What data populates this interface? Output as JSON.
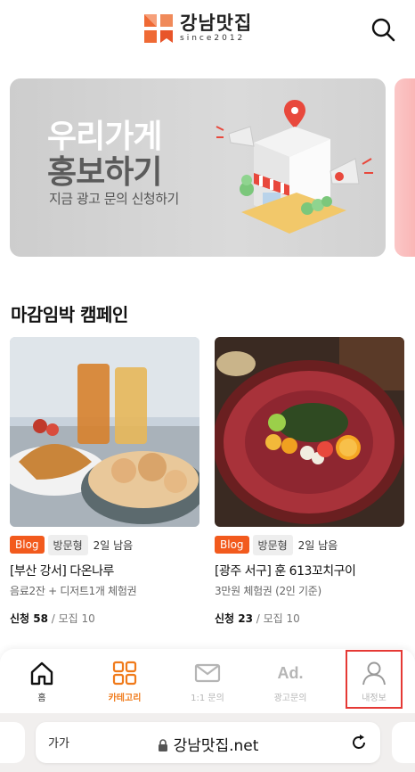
{
  "header": {
    "brand_name": "강남맛집",
    "brand_since": "since2012"
  },
  "banner": {
    "title_line1": "우리가게",
    "title_line2": "홍보하기",
    "subtitle": "지금 광고 문의 신청하기"
  },
  "section": {
    "title": "마감임박 캠페인"
  },
  "campaigns": [
    {
      "blog_tag": "Blog",
      "type_tag": "방문형",
      "days_left": "2일 남음",
      "title": "[부산 강서] 다온나루",
      "desc": "음료2잔 + 디저트1개 체험권",
      "applied_label": "신청 58",
      "recruit_label": " / 모집 10"
    },
    {
      "blog_tag": "Blog",
      "type_tag": "방문형",
      "days_left": "2일 남음",
      "title": "[광주 서구] 훈 613꼬치구이",
      "desc": "3만원 체험권 (2인 기준)",
      "applied_label": "신청 23",
      "recruit_label": " / 모집 10"
    }
  ],
  "bottom_nav": {
    "items": [
      {
        "label": "홈",
        "icon": "home-icon"
      },
      {
        "label": "카테고리",
        "icon": "grid-icon"
      },
      {
        "label": "1:1 문의",
        "icon": "mail-icon"
      },
      {
        "label": "광고문의",
        "icon": "ad-icon",
        "icon_text": "Ad."
      },
      {
        "label": "내정보",
        "icon": "user-icon"
      }
    ],
    "active_color": "#f07a1a",
    "muted_color": "#b5b5b5"
  },
  "browser": {
    "text_size_label": "가가",
    "url": "강남맛집.net"
  },
  "colors": {
    "accent": "#f25a1d",
    "highlight_box": "#e53935"
  }
}
